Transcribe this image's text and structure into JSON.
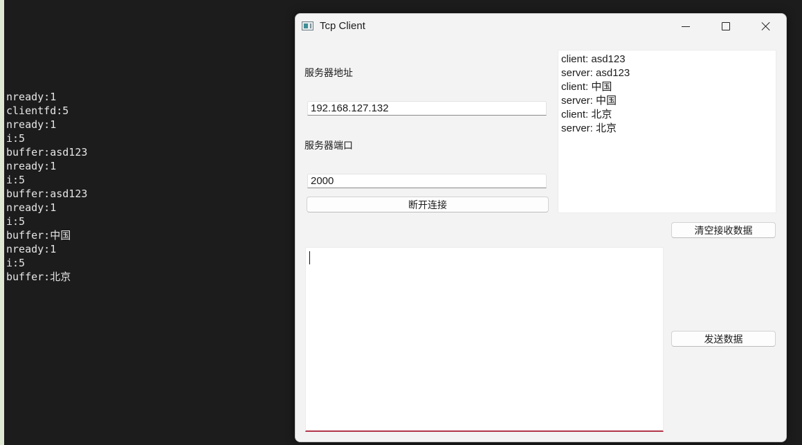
{
  "terminal": {
    "lines": [
      "nready:1",
      "clientfd:5",
      "nready:1",
      "i:5",
      "buffer:asd123",
      "nready:1",
      "i:5",
      "buffer:asd123",
      "nready:1",
      "i:5",
      "buffer:中国",
      "nready:1",
      "i:5",
      "buffer:北京"
    ]
  },
  "window": {
    "title": "Tcp Client",
    "icon": "app-window-icon",
    "controls": [
      "minimize-icon",
      "maximize-icon",
      "close-icon"
    ]
  },
  "form": {
    "address_label": "服务器地址",
    "address_value": "192.168.127.132",
    "port_label": "服务器端口",
    "port_value": "2000",
    "disconnect_label": "断开连接"
  },
  "receive": {
    "messages": [
      "client: asd123",
      "server: asd123",
      "client: 中国",
      "server: 中国",
      "client: 北京",
      "server: 北京"
    ],
    "clear_label": "清空接收数据"
  },
  "send": {
    "text": "",
    "send_label": "发送数据"
  },
  "colors": {
    "desktop_bg": "#1c1c1c",
    "window_bg": "#f3f3f3",
    "focus_underline": "#b23448"
  }
}
